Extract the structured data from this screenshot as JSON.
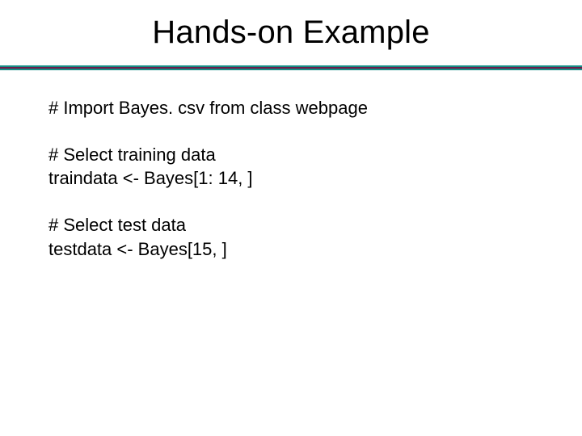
{
  "title": "Hands-on Example",
  "blocks": {
    "b1": {
      "l1": "# Import Bayes. csv from class webpage"
    },
    "b2": {
      "l1": "# Select training data",
      "l2": "traindata <- Bayes[1: 14, ]"
    },
    "b3": {
      "l1": "# Select test data",
      "l2": "testdata <- Bayes[15, ]"
    }
  }
}
